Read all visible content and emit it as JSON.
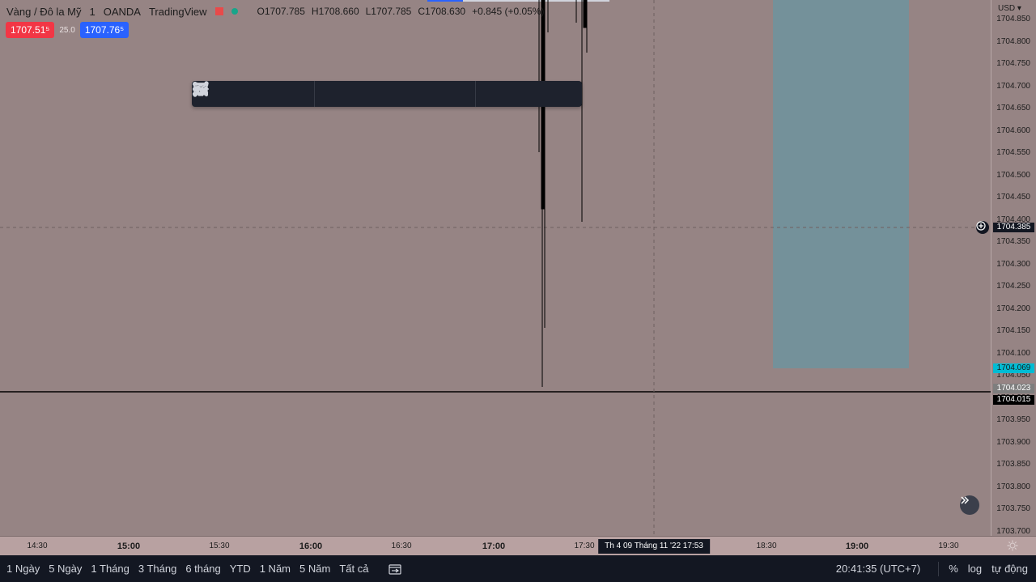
{
  "legend": {
    "symbol": "Vàng / Đô la Mỹ",
    "interval": "1",
    "broker": "OANDA",
    "source": "TradingView",
    "open": "O1707.785",
    "high": "H1708.660",
    "low": "L1707.785",
    "close": "C1708.630",
    "change": "+0.845 (+0.05%)"
  },
  "quote": {
    "sell": "1707.51⁵",
    "spread": "25.0",
    "buy": "1707.76⁵"
  },
  "toolbar_tools": [
    "brush-icon",
    "fib-retracement-icon",
    "horizontal-ray-icon",
    "horizontal-line-icon",
    "rectangle-icon",
    "text-icon",
    "trend-line-icon",
    "parallel-channel-icon",
    "path-icon",
    "pitchfork-icon",
    "long-position-icon",
    "callout-icon",
    "balloon-icon",
    "measure-icon"
  ],
  "price_axis": {
    "currency": "USD",
    "ticks": [
      "1704.850",
      "1704.800",
      "1704.750",
      "1704.700",
      "1704.650",
      "1704.600",
      "1704.550",
      "1704.500",
      "1704.450",
      "1704.400",
      "1704.350",
      "1704.300",
      "1704.250",
      "1704.200",
      "1704.150",
      "1704.100",
      "1704.050",
      "1704.000",
      "1703.950",
      "1703.900",
      "1703.850",
      "1703.800",
      "1703.750",
      "1703.700"
    ],
    "tag_crosshair": "1704.385",
    "tag_cyan": "1704.069",
    "tag_gray": "1704.023",
    "tag_black": "1704.015"
  },
  "time_axis": {
    "ticks": [
      {
        "label": "14:30",
        "bold": false
      },
      {
        "label": "15:00",
        "bold": true
      },
      {
        "label": "15:30",
        "bold": false
      },
      {
        "label": "16:00",
        "bold": true
      },
      {
        "label": "16:30",
        "bold": false
      },
      {
        "label": "17:00",
        "bold": true
      },
      {
        "label": "17:30",
        "bold": false
      },
      {
        "label": "18:30",
        "bold": false
      },
      {
        "label": "19:00",
        "bold": true
      },
      {
        "label": "19:30",
        "bold": false
      }
    ],
    "cursor_label": "Th 4 09 Tháng 11 '22   17:53"
  },
  "bottom_bar": {
    "ranges": [
      "1 Ngày",
      "5 Ngày",
      "1 Tháng",
      "3 Tháng",
      "6 tháng",
      "YTD",
      "1 Năm",
      "5 Năm",
      "Tất cả"
    ],
    "clock": "20:41:35 (UTC+7)",
    "percent": "%",
    "log": "log",
    "auto": "tự động"
  },
  "colors": {
    "background": "#968484",
    "zone": "#74919a",
    "sell": "#f23645",
    "buy": "#2962ff"
  }
}
